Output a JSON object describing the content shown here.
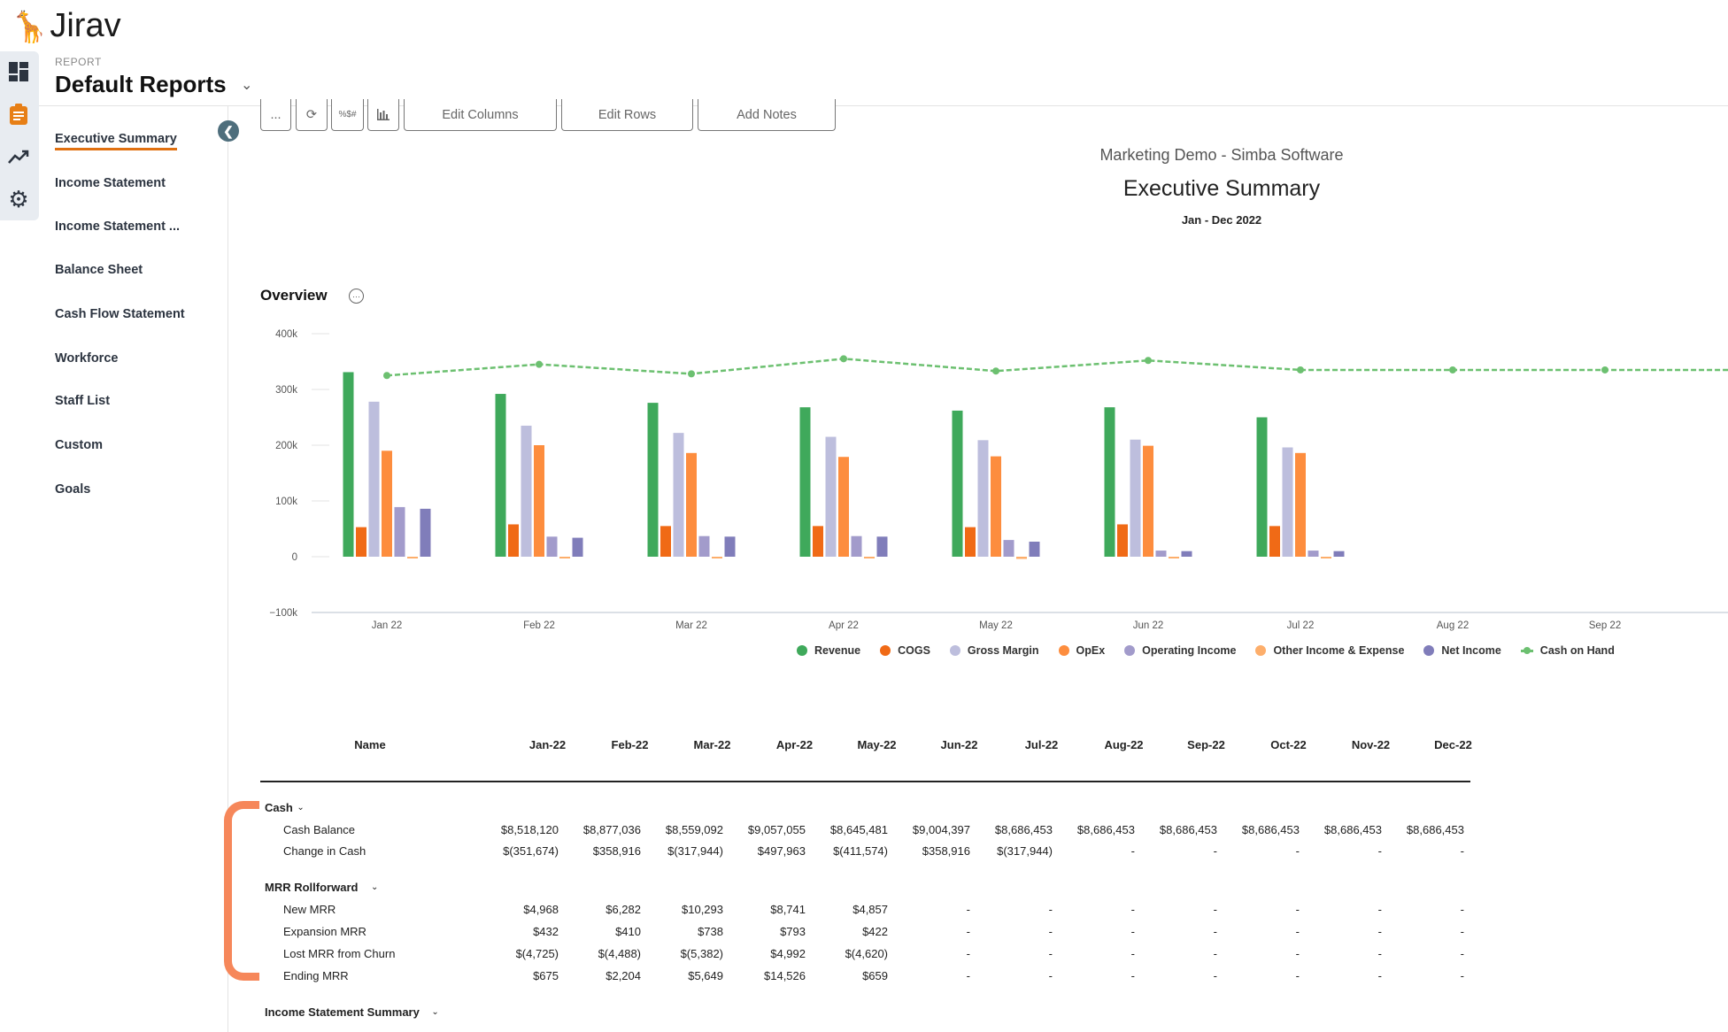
{
  "app": {
    "logo": "Jirav",
    "rail": [
      {
        "icon": "dashboard-icon"
      },
      {
        "icon": "clipboard-icon",
        "active": true
      },
      {
        "icon": "trend-icon"
      },
      {
        "icon": "gear-icon"
      }
    ]
  },
  "header": {
    "label": "REPORT",
    "title": "Default Reports"
  },
  "sidebar": {
    "items": [
      {
        "label": "Executive Summary",
        "active": true
      },
      {
        "label": "Income Statement"
      },
      {
        "label": "Income Statement ..."
      },
      {
        "label": "Balance Sheet"
      },
      {
        "label": "Cash Flow Statement"
      },
      {
        "label": "Workforce"
      },
      {
        "label": "Staff List"
      },
      {
        "label": "Custom"
      },
      {
        "label": "Goals"
      }
    ]
  },
  "toolbar": {
    "more": "...",
    "refresh_icon": "refresh-icon",
    "format_icon": "number-format-icon",
    "chart_icon": "bar-chart-icon",
    "edit_columns": "Edit Columns",
    "edit_rows": "Edit Rows",
    "add_notes": "Add Notes"
  },
  "report": {
    "company": "Marketing Demo - Simba Software",
    "title": "Executive Summary",
    "period": "Jan - Dec 2022"
  },
  "overview": {
    "title": "Overview",
    "more": "···"
  },
  "chart_data": {
    "type": "bar",
    "categories": [
      "Jan 22",
      "Feb 22",
      "Mar 22",
      "Apr 22",
      "May 22",
      "Jun 22",
      "Jul 22",
      "Aug 22",
      "Sep 22"
    ],
    "y_ticks": [
      "400k",
      "300k",
      "200k",
      "100k",
      "0",
      "−100k"
    ],
    "ylim": [
      -100000,
      400000
    ],
    "legend_position": "bottom",
    "series": [
      {
        "name": "Revenue",
        "type": "bar",
        "color": "#3fa95b",
        "values": [
          331000,
          292000,
          276000,
          268000,
          262000,
          268000,
          250000,
          null,
          null
        ]
      },
      {
        "name": "COGS",
        "type": "bar",
        "color": "#f06a16",
        "values": [
          53000,
          58000,
          55000,
          55000,
          53000,
          58000,
          55000,
          null,
          null
        ]
      },
      {
        "name": "Gross Margin",
        "type": "bar",
        "color": "#bdbedd",
        "values": [
          278000,
          235000,
          222000,
          215000,
          209000,
          210000,
          196000,
          null,
          null
        ]
      },
      {
        "name": "OpEx",
        "type": "bar",
        "color": "#fd8d3e",
        "values": [
          190000,
          200000,
          186000,
          179000,
          180000,
          199000,
          186000,
          null,
          null
        ]
      },
      {
        "name": "Operating Income",
        "type": "bar",
        "color": "#a29bcb",
        "values": [
          89000,
          36000,
          37000,
          37000,
          30000,
          11000,
          11000,
          null,
          null
        ]
      },
      {
        "name": "Other Income & Expense",
        "type": "bar",
        "color": "#fdae6b",
        "values": [
          -3000,
          -2000,
          -2000,
          -2000,
          -4000,
          -2000,
          -2000,
          null,
          null
        ]
      },
      {
        "name": "Net Income",
        "type": "bar",
        "color": "#807dba",
        "values": [
          86000,
          34000,
          36000,
          36000,
          27000,
          10000,
          10000,
          null,
          null
        ]
      },
      {
        "name": "Cash on Hand",
        "type": "line",
        "color": "#6cc070",
        "values": [
          325000,
          345000,
          328000,
          355000,
          333000,
          352000,
          335000,
          335000,
          335000
        ]
      }
    ]
  },
  "table": {
    "columns": [
      "Name",
      "Jan-22",
      "Feb-22",
      "Mar-22",
      "Apr-22",
      "May-22",
      "Jun-22",
      "Jul-22",
      "Aug-22",
      "Sep-22",
      "Oct-22",
      "Nov-22",
      "Dec-22"
    ],
    "sections": [
      {
        "label": "Cash",
        "rows": [
          {
            "label": "Cash Balance",
            "values": [
              "$8,518,120",
              "$8,877,036",
              "$8,559,092",
              "$9,057,055",
              "$8,645,481",
              "$9,004,397",
              "$8,686,453",
              "$8,686,453",
              "$8,686,453",
              "$8,686,453",
              "$8,686,453",
              "$8,686,453"
            ]
          },
          {
            "label": "Change in Cash",
            "values": [
              "$(351,674)",
              "$358,916",
              "$(317,944)",
              "$497,963",
              "$(411,574)",
              "$358,916",
              "$(317,944)",
              "-",
              "-",
              "-",
              "-",
              "-"
            ]
          }
        ]
      },
      {
        "label": "MRR Rollforward",
        "rows": [
          {
            "label": "New MRR",
            "values": [
              "$4,968",
              "$6,282",
              "$10,293",
              "$8,741",
              "$4,857",
              "-",
              "-",
              "-",
              "-",
              "-",
              "-",
              "-"
            ]
          },
          {
            "label": "Expansion MRR",
            "values": [
              "$432",
              "$410",
              "$738",
              "$793",
              "$422",
              "-",
              "-",
              "-",
              "-",
              "-",
              "-",
              "-"
            ]
          },
          {
            "label": "Lost MRR from Churn",
            "values": [
              "$(4,725)",
              "$(4,488)",
              "$(5,382)",
              "$4,992",
              "$(4,620)",
              "-",
              "-",
              "-",
              "-",
              "-",
              "-",
              "-"
            ]
          },
          {
            "label": "Ending MRR",
            "values": [
              "$675",
              "$2,204",
              "$5,649",
              "$14,526",
              "$659",
              "-",
              "-",
              "-",
              "-",
              "-",
              "-",
              "-"
            ]
          }
        ]
      },
      {
        "label": "Income Statement Summary",
        "rows": []
      }
    ]
  },
  "highlight_color": "#f6875a"
}
